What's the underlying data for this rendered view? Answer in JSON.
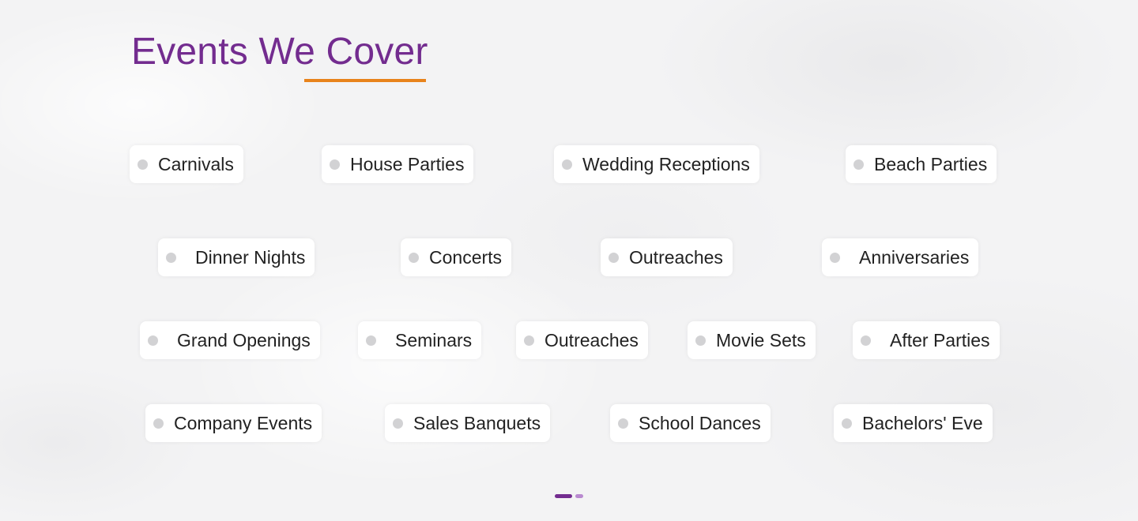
{
  "section": {
    "title": "Events We Cover"
  },
  "events": {
    "row1": [
      "Carnivals",
      "House Parties",
      "Wedding Receptions",
      "Beach Parties"
    ],
    "row2": [
      "Dinner Nights",
      "Concerts",
      "Outreaches",
      "Anniversaries"
    ],
    "row3": [
      "Grand Openings",
      "Seminars",
      "Outreaches",
      "Movie Sets",
      "After Parties"
    ],
    "row4": [
      "Company Events",
      "Sales Banquets",
      "School Dances",
      "Bachelors' Eve"
    ]
  },
  "pagination": {
    "pages": 2,
    "active_page": 1
  },
  "colors": {
    "title": "#732c8f",
    "underline_accent": "#e8831b",
    "bullet": "#d2d2d4",
    "pager_active": "#732c8f",
    "pager_inactive": "#b98ad0"
  }
}
